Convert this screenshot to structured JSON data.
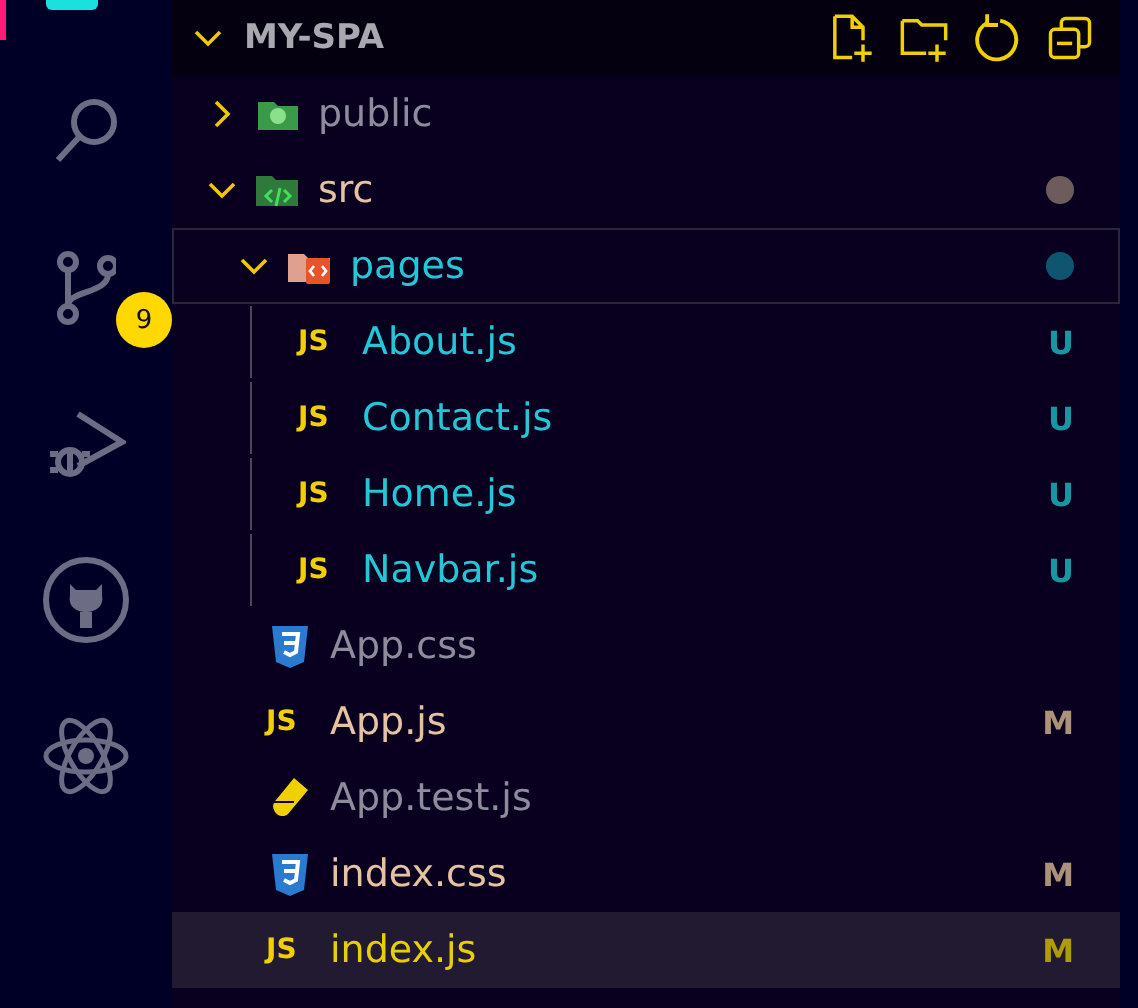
{
  "activity_bar": {
    "items": [
      {
        "kind": "search"
      },
      {
        "kind": "source-control",
        "badge": "9"
      },
      {
        "kind": "run-debug"
      },
      {
        "kind": "github"
      },
      {
        "kind": "react"
      }
    ]
  },
  "explorer": {
    "title": "MY-SPA",
    "expanded": true,
    "tree": [
      {
        "name": "public",
        "kind": "folder-public",
        "expanded": false,
        "color": "#8e8c9c",
        "selected": false,
        "focused": false
      },
      {
        "name": "src",
        "kind": "folder-src",
        "expanded": true,
        "color": "#e6c2a2",
        "selected": false,
        "focused": false,
        "dot": {
          "color": "#6e5c5c"
        },
        "children": [
          {
            "name": "pages",
            "kind": "folder-pages",
            "expanded": true,
            "color": "#22c8d8",
            "selected": false,
            "focused": true,
            "dot": {
              "color": "#0e5670"
            },
            "children": [
              {
                "name": "About.js",
                "kind": "js",
                "icon_text": "JS",
                "color": "#22c8d8",
                "badge": "U",
                "selected": false,
                "focused": false
              },
              {
                "name": "Contact.js",
                "kind": "js",
                "icon_text": "JS",
                "color": "#22c8d8",
                "badge": "U",
                "selected": false,
                "focused": false
              },
              {
                "name": "Home.js",
                "kind": "js",
                "icon_text": "JS",
                "color": "#22c8d8",
                "badge": "U",
                "selected": false,
                "focused": false
              },
              {
                "name": "Navbar.js",
                "kind": "js",
                "icon_text": "JS",
                "color": "#22c8d8",
                "badge": "U",
                "selected": false,
                "focused": false
              }
            ]
          },
          {
            "name": "App.css",
            "kind": "css",
            "color": "#8e8c9c",
            "selected": false,
            "focused": false
          },
          {
            "name": "App.js",
            "kind": "js",
            "icon_text": "JS",
            "color": "#e6c2a2",
            "badge": "M",
            "selected": false,
            "focused": false
          },
          {
            "name": "App.test.js",
            "kind": "test",
            "color": "#8e8c9c",
            "selected": false,
            "focused": false
          },
          {
            "name": "index.css",
            "kind": "css",
            "color": "#e6c2a2",
            "badge": "M",
            "selected": false,
            "focused": false
          },
          {
            "name": "index.js",
            "kind": "js",
            "icon_text": "JS",
            "color": "#e8d000",
            "badge": "M",
            "selected": true,
            "focused": false
          }
        ]
      }
    ]
  }
}
